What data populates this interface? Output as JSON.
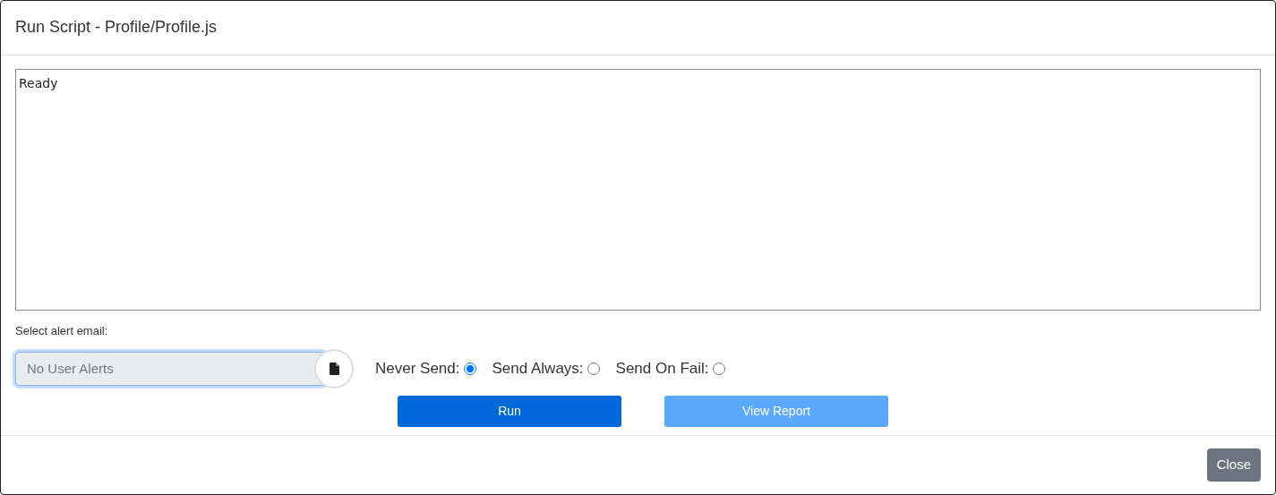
{
  "window": {
    "title": "Run Script - Profile/Profile.js"
  },
  "output": {
    "value": "Ready"
  },
  "alert_email": {
    "label": "Select alert email:",
    "placeholder": "No User Alerts"
  },
  "send_options": [
    {
      "label": "Never Send:",
      "selected": true
    },
    {
      "label": "Send Always:",
      "selected": false
    },
    {
      "label": "Send On Fail:",
      "selected": false
    }
  ],
  "actions": [
    {
      "label": "Run",
      "disabled": false
    },
    {
      "label": "View Report",
      "disabled": true
    }
  ],
  "footer": {
    "close": "Close"
  }
}
